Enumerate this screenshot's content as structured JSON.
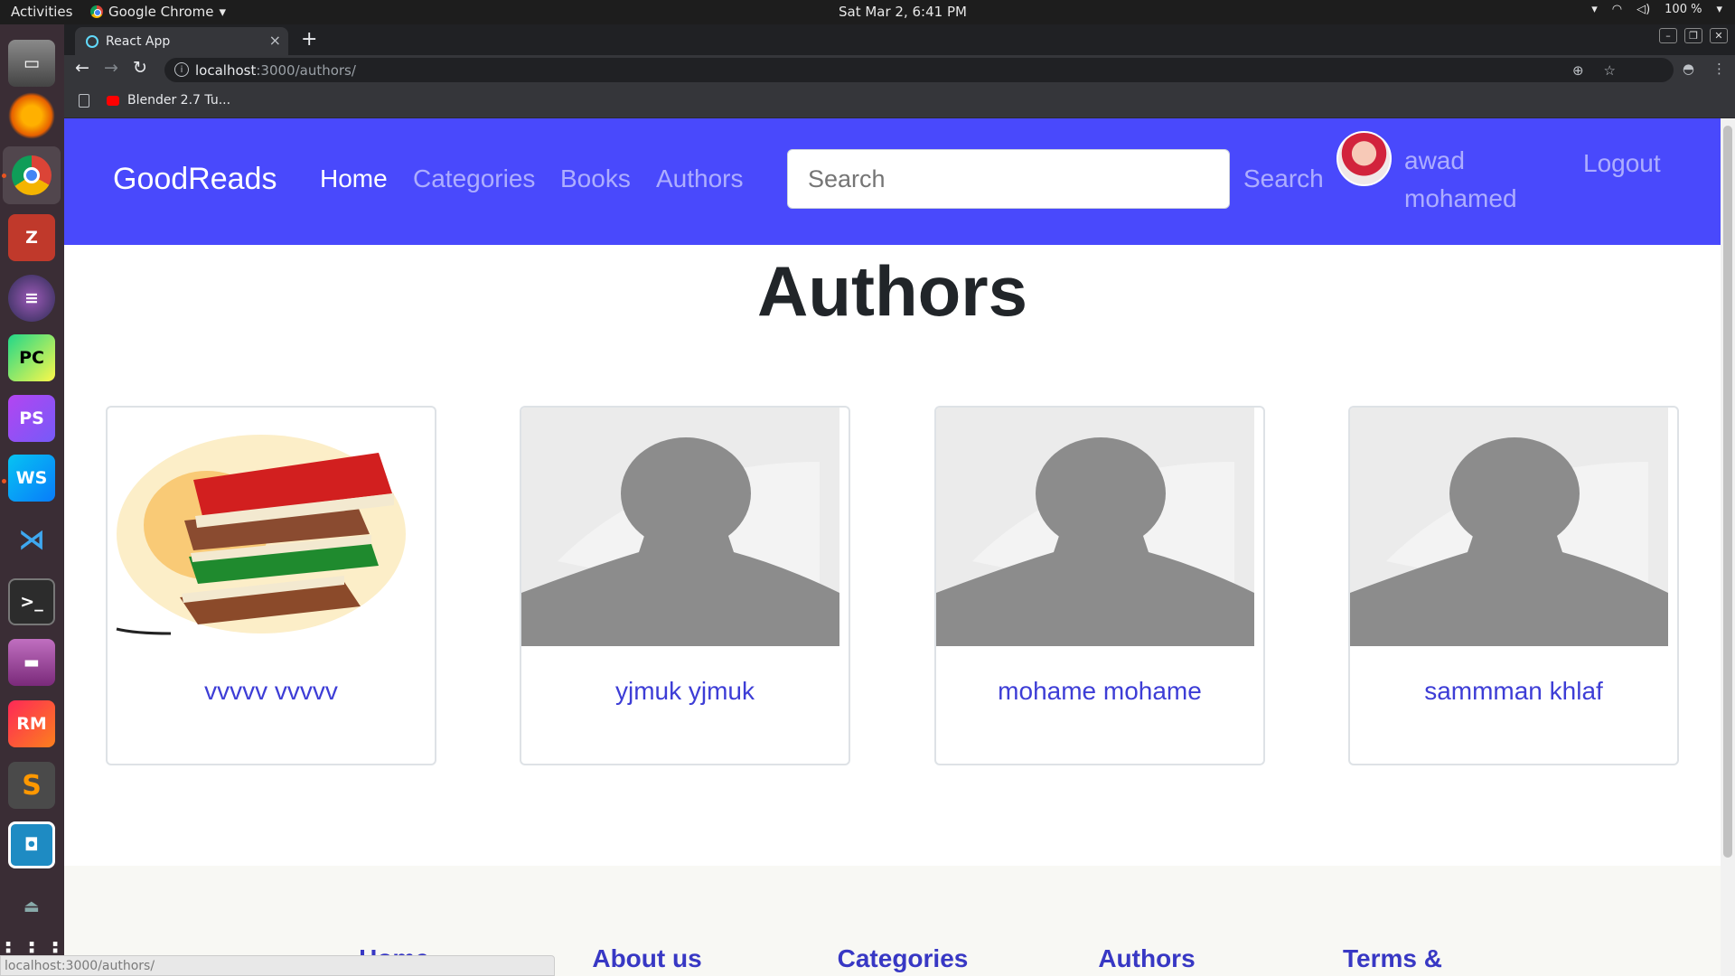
{
  "os": {
    "activities": "Activities",
    "app_menu": "Google Chrome",
    "clock": "Sat Mar  2,  6:41 PM",
    "battery": "100 %"
  },
  "browser": {
    "tab_title": "React App",
    "url_host": "localhost",
    "url_path": ":3000/authors/",
    "bookmark": "Blender 2.7 Tu...",
    "status_url": "localhost:3000/authors/"
  },
  "navbar": {
    "brand": "GoodReads",
    "links": [
      "Home",
      "Categories",
      "Books",
      "Authors"
    ],
    "search_placeholder": "Search",
    "search_button": "Search",
    "user_first": "awad",
    "user_last": "mohamed",
    "logout": "Logout",
    "color": "#4949fc"
  },
  "main": {
    "title": "Authors",
    "authors": [
      {
        "name": "vvvvv vvvvv",
        "image": "books-stack"
      },
      {
        "name": "yjmuk yjmuk",
        "image": "person-placeholder"
      },
      {
        "name": "mohame mohame",
        "image": "person-placeholder"
      },
      {
        "name": "sammman khlaf",
        "image": "person-placeholder"
      }
    ]
  },
  "footer": {
    "links": [
      "Home",
      "About us",
      "Categories",
      "Authors",
      "Terms & Conditions"
    ]
  }
}
